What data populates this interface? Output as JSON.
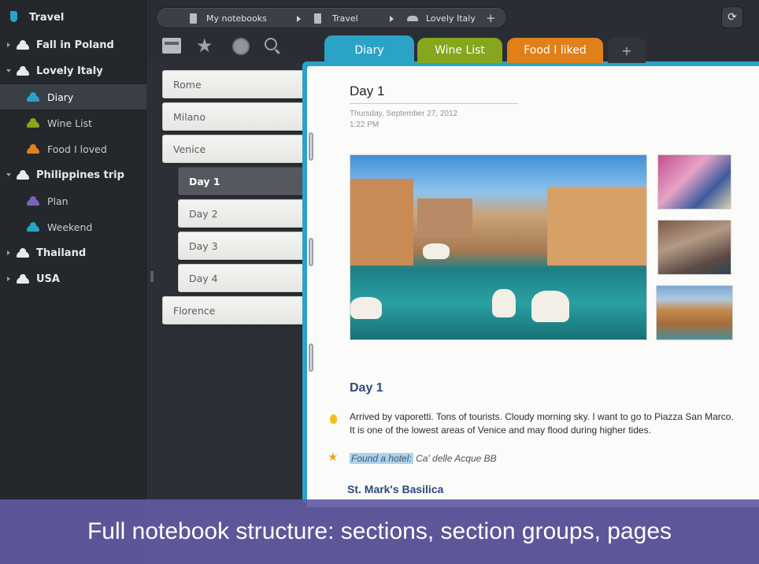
{
  "sidebar": {
    "notebook_title": "Travel",
    "items": [
      {
        "label": "Fall in Poland",
        "level": 0,
        "expanded": false,
        "icon": "cloud-icon",
        "color": "#e8e9eb"
      },
      {
        "label": "Lovely Italy",
        "level": 0,
        "expanded": true,
        "icon": "cloud-icon",
        "color": "#e8e9eb"
      },
      {
        "label": "Diary",
        "level": 1,
        "selected": true,
        "icon": "cloud-icon",
        "color": "#2aa3c7"
      },
      {
        "label": "Wine List",
        "level": 1,
        "icon": "cloud-icon",
        "color": "#86a61d"
      },
      {
        "label": "Food I loved",
        "level": 1,
        "icon": "cloud-icon",
        "color": "#e0801a"
      },
      {
        "label": "Philippines trip",
        "level": 0,
        "expanded": true,
        "icon": "cloud-icon",
        "color": "#e8e9eb"
      },
      {
        "label": "Plan",
        "level": 1,
        "icon": "cloud-icon",
        "color": "#7b63b8"
      },
      {
        "label": "Weekend",
        "level": 1,
        "icon": "cloud-icon",
        "color": "#2aa3c7"
      },
      {
        "label": "Thailand",
        "level": 0,
        "expanded": false,
        "icon": "cloud-icon",
        "color": "#e8e9eb"
      },
      {
        "label": "USA",
        "level": 0,
        "expanded": false,
        "icon": "cloud-icon",
        "color": "#e8e9eb"
      }
    ]
  },
  "breadcrumb": {
    "items": [
      "My notebooks",
      "Travel",
      "Lovely Italy"
    ],
    "add": "+"
  },
  "toolbar": {
    "icons": [
      "inbox-icon",
      "star-icon",
      "clock-icon",
      "search-icon"
    ],
    "sync_icon": "⟳"
  },
  "pages": [
    {
      "label": "Rome",
      "sub": false
    },
    {
      "label": "Milano",
      "sub": false
    },
    {
      "label": "Venice",
      "sub": false
    },
    {
      "label": "Day 1",
      "sub": true,
      "active": true
    },
    {
      "label": "Day 2",
      "sub": true
    },
    {
      "label": "Day 3",
      "sub": true
    },
    {
      "label": "Day 4",
      "sub": true
    },
    {
      "label": "Florence",
      "sub": false
    }
  ],
  "tabs": [
    {
      "label": "Diary",
      "color": "#2aa3c7",
      "active": true
    },
    {
      "label": "Wine List",
      "color": "#86a61d"
    },
    {
      "label": "Food I liked",
      "color": "#e0801a"
    },
    {
      "label": "+",
      "color": "#32353b"
    }
  ],
  "note": {
    "title": "Day 1",
    "date": "Thursday, September 27, 2012",
    "time": "1:22 PM",
    "heading": "Day 1",
    "paragraph": "Arrived by vaporetti. Tons of tourists. Cloudy morning sky.  I want to go to Piazza San Marco. It is one of the lowest areas of Venice and may flood during higher tides.",
    "found_label": "Found a hotel:",
    "found_value": "Ca' delle Acque BB",
    "subheading": "St. Mark's Basilica"
  },
  "banner": {
    "text": "Full notebook structure: sections, section groups, pages",
    "color": "#625aa2"
  }
}
